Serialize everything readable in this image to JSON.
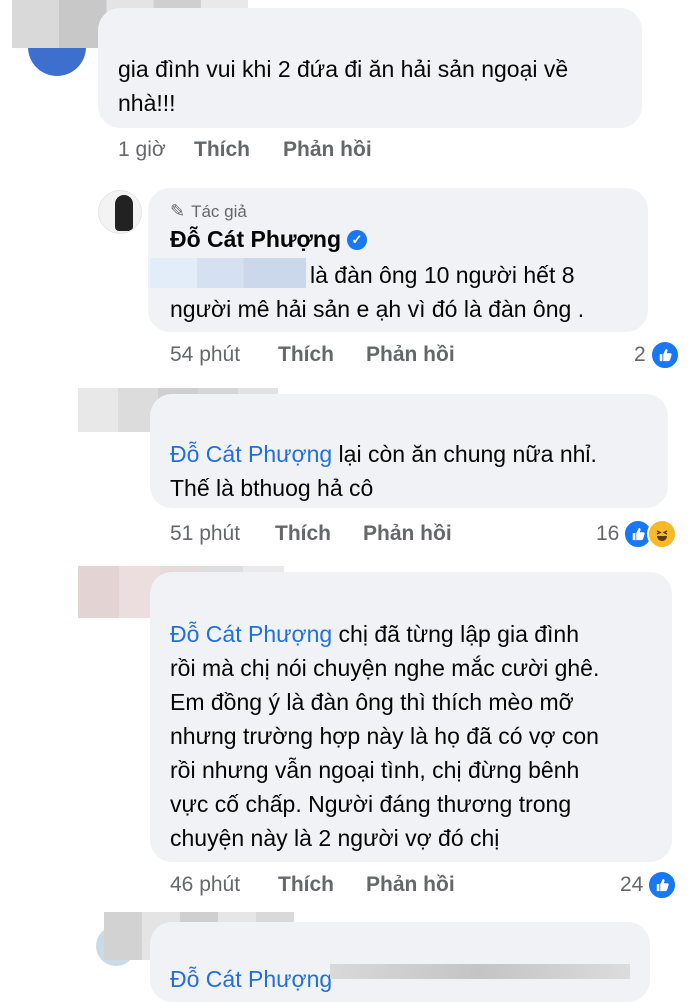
{
  "comments": [
    {
      "text": "gia đình vui khi 2 đứa đi ăn hải sản ngoại về nhà!!!",
      "line1": "gia đình vui khi 2 đứa đi ăn hải sản ngoại về",
      "line2": "nhà!!!",
      "time": "1 giờ",
      "like_label": "Thích",
      "reply_label": "Phản hồi"
    },
    {
      "author_badge": "Tác giả",
      "author": "Đỗ Cát Phượng",
      "line1_suffix": "là đàn ông 10 người hết 8",
      "line2": "người mê hải sản e ạh vì đó là đàn ông .",
      "time": "54 phút",
      "like_label": "Thích",
      "reply_label": "Phản hồi",
      "reaction_count": "2"
    },
    {
      "mention": "Đỗ Cát Phượng",
      "line1_suffix": " lại còn ăn chung nữa nhỉ.",
      "line2": "Thế là bthuog hả cô",
      "time": "51 phút",
      "like_label": "Thích",
      "reply_label": "Phản hồi",
      "reaction_count": "16"
    },
    {
      "mention": "Đỗ Cát Phượng",
      "line1_suffix": " chị đã từng lập gia đình",
      "lines": [
        "rồi mà chị nói chuyện nghe mắc cười ghê.",
        "Em đồng ý là đàn ông thì thích mèo mỡ",
        "nhưng trường hợp này là họ đã có vợ con",
        "rồi nhưng vẫn ngoại tình, chị đừng bênh",
        "vực cố chấp. Người đáng thương trong",
        "chuyện này là 2 người vợ đó chị"
      ],
      "time": "46 phút",
      "like_label": "Thích",
      "reply_label": "Phản hồi",
      "reaction_count": "24"
    },
    {
      "partial_text": "Đỗ Cát Phượng"
    }
  ]
}
